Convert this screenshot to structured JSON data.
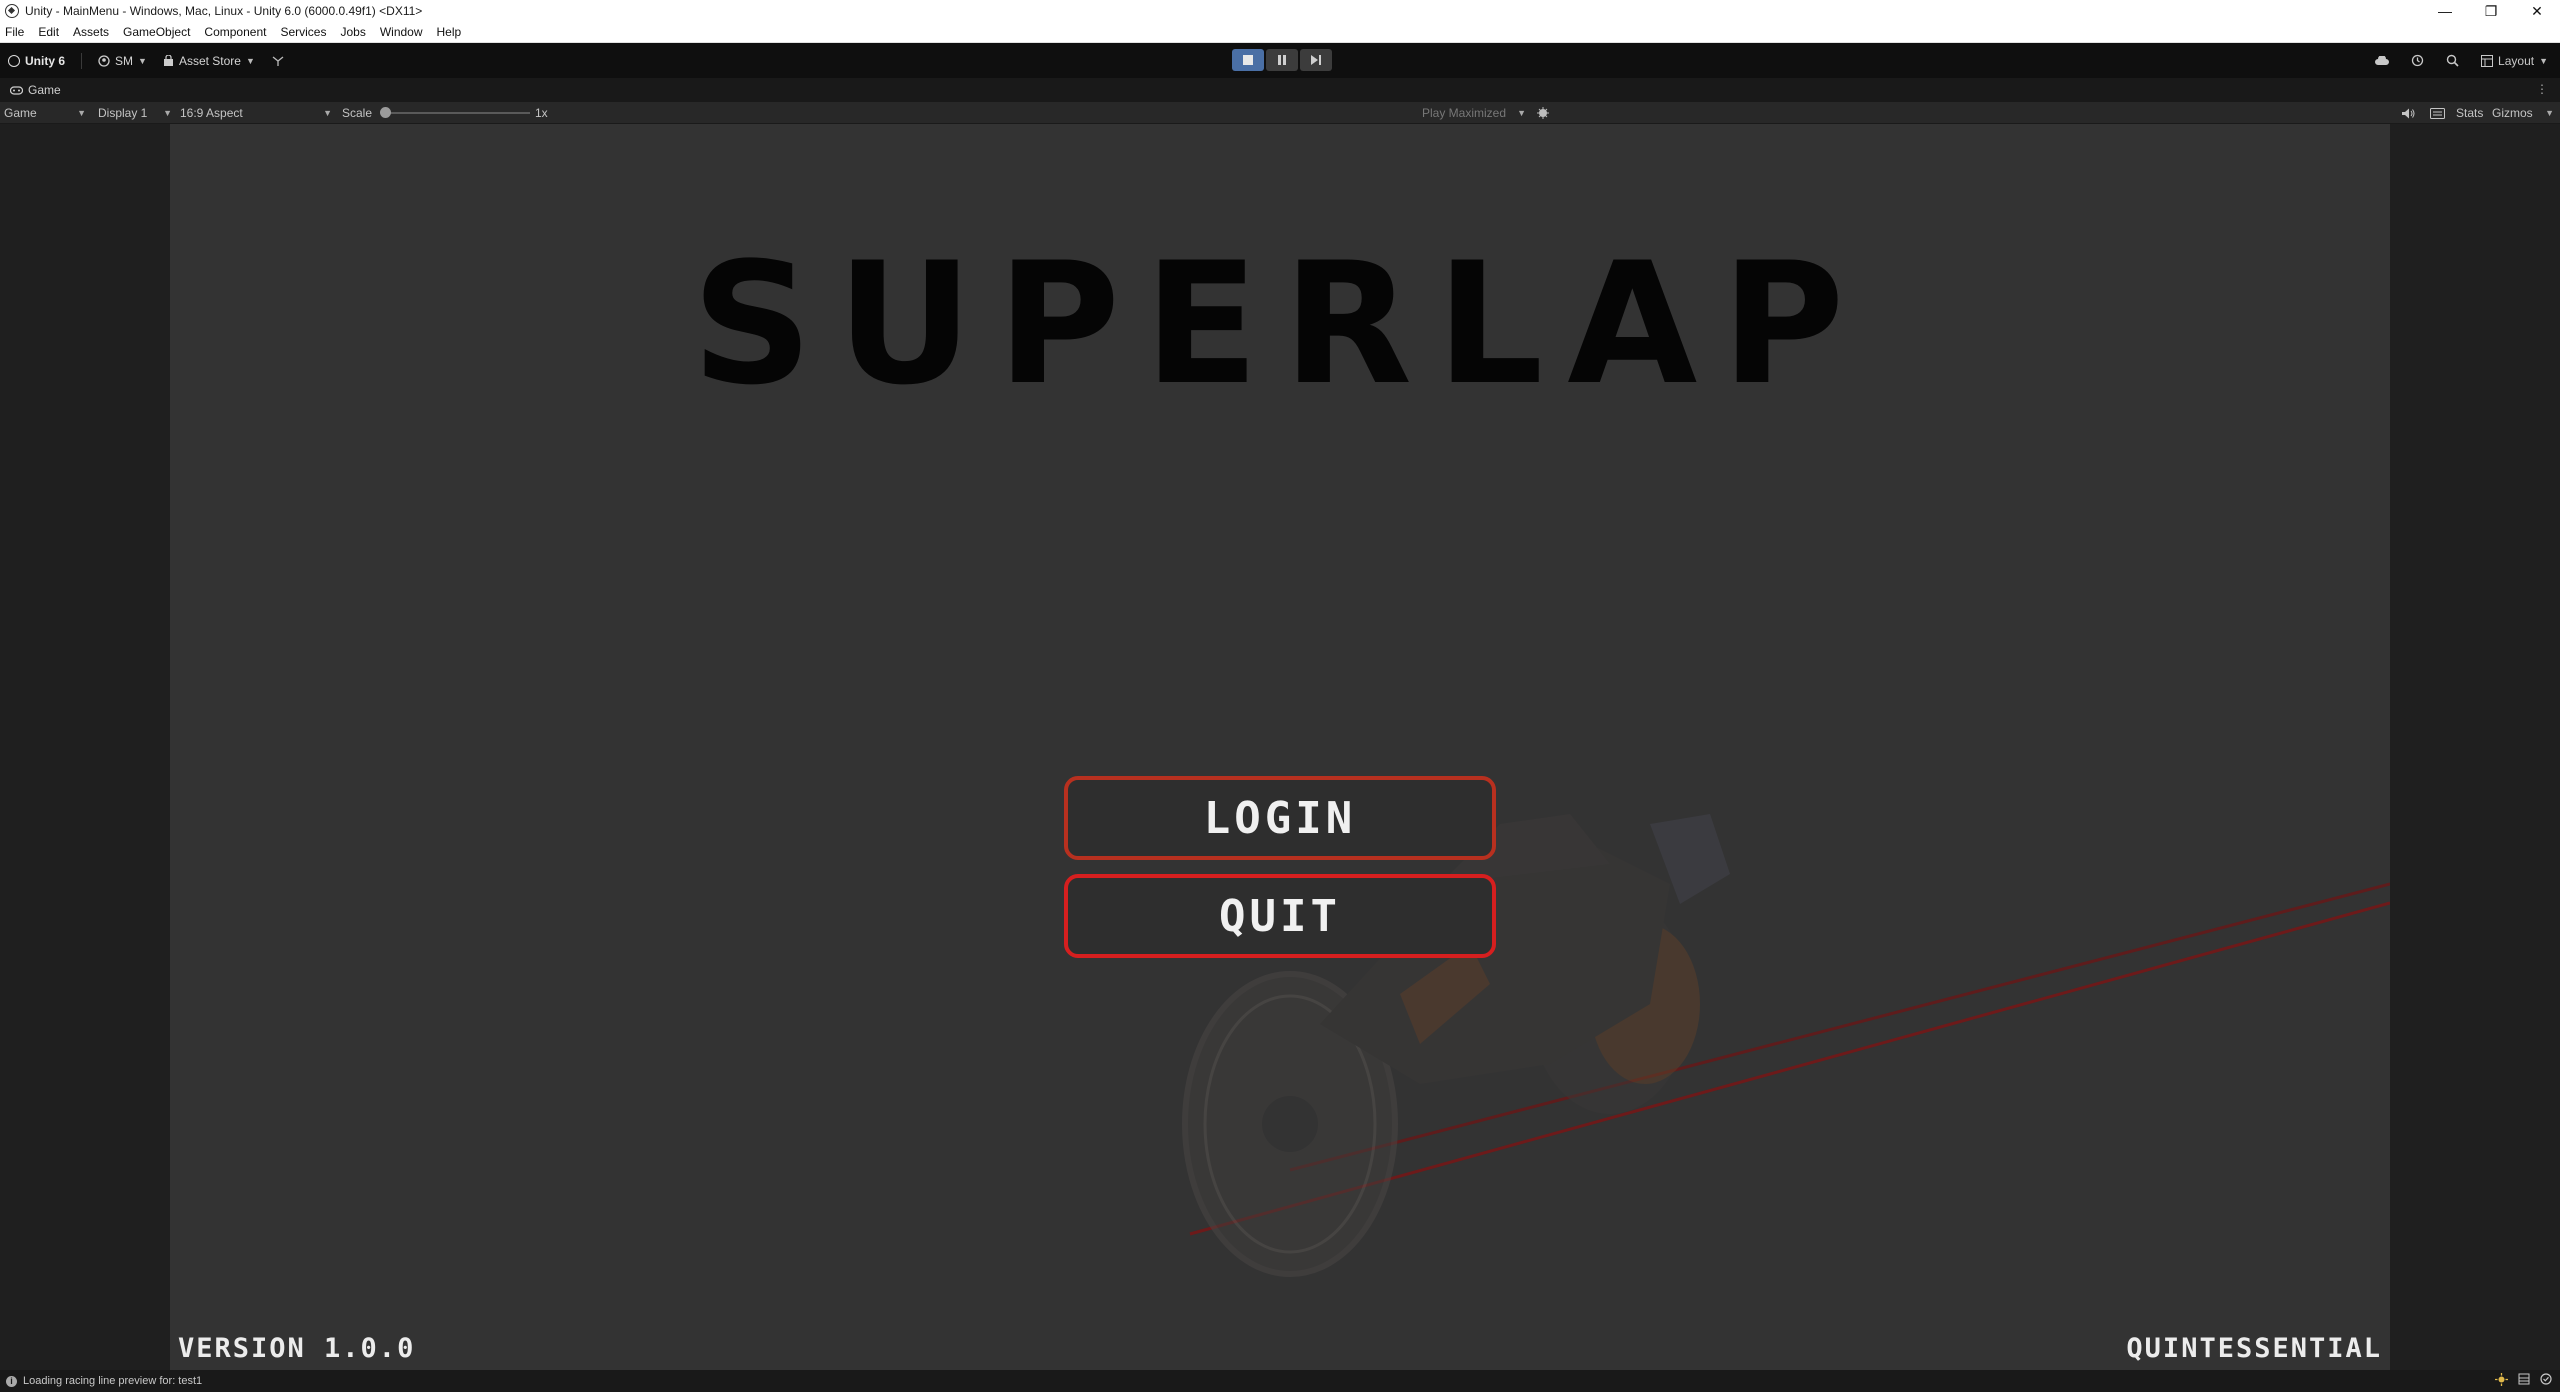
{
  "window": {
    "title": "Unity - MainMenu - Windows, Mac, Linux - Unity 6.0 (6000.0.49f1) <DX11>",
    "controls": [
      "—",
      "❐",
      "✕"
    ]
  },
  "menubar": [
    "File",
    "Edit",
    "Assets",
    "GameObject",
    "Component",
    "Services",
    "Jobs",
    "Window",
    "Help"
  ],
  "toolbar": {
    "unity_label": "Unity 6",
    "account_label": "SM",
    "asset_store_label": "Asset Store",
    "layout_label": "Layout",
    "accent": "#4a6fa5"
  },
  "game_view": {
    "tab_label": "Game",
    "mode_dropdown": "Game",
    "display_dropdown": "Display 1",
    "aspect_dropdown": "16:9 Aspect",
    "scale_label": "Scale",
    "scale_value": "1x",
    "play_mode_dropdown": "Play Maximized",
    "stats_label": "Stats",
    "gizmos_label": "Gizmos"
  },
  "game": {
    "title": "SUPERLAP",
    "login_label": "LOGIN",
    "quit_label": "QUIT",
    "version_text": "VERSION 1.0.0",
    "studio_text": "QUINTESSENTIAL",
    "button_border_color": "#d61f1f"
  },
  "status": {
    "message": "Loading racing line preview for: test1"
  }
}
